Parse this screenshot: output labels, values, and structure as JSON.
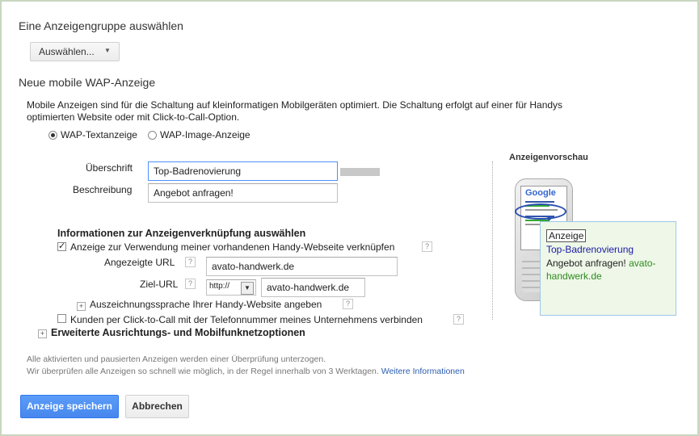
{
  "adgroup": {
    "heading": "Eine Anzeigengruppe auswählen",
    "select_label": "Auswählen..."
  },
  "new_ad": {
    "heading": "Neue mobile WAP-Anzeige",
    "description_line1": "Mobile Anzeigen sind für die Schaltung auf kleinformatigen Mobilgeräten optimiert. Die Schaltung erfolgt auf einer für Handys",
    "description_line2": "optimierten Website oder mit Click-to-Call-Option.",
    "radio_text": "WAP-Textanzeige",
    "radio_image": "WAP-Image-Anzeige"
  },
  "form": {
    "headline_label": "Überschrift",
    "headline_value": "Top-Badrenovierung",
    "description_label": "Beschreibung",
    "description_value": "Angebot anfragen!"
  },
  "linking": {
    "heading": "Informationen zur Anzeigenverknüpfung auswählen",
    "checkbox_label": "Anzeige zur Verwendung meiner vorhandenen Handy-Webseite verknüpfen",
    "display_url_label": "Angezeigte URL",
    "display_url_value": "avato-handwerk.de",
    "dest_url_label": "Ziel-URL",
    "protocol_value": "http://",
    "dest_url_value": "avato-handwerk.de",
    "markup_label": "Auszeichnungssprache Ihrer Handy-Website angeben",
    "call_label": "Kunden per Click-to-Call mit der Telefonnummer meines Unternehmens verbinden",
    "advanced_label": "Erweiterte Ausrichtungs- und Mobilfunknetzoptionen"
  },
  "help_glyph": "?",
  "expand_glyph": "+",
  "preview": {
    "title": "Anzeigenvorschau",
    "badge": "Anzeige",
    "ad_title": "Top-Badrenovierung",
    "ad_desc": "Angebot anfragen!",
    "ad_url_part1": "avato-",
    "ad_url_part2": "handwerk.de",
    "phone_logo": "Google"
  },
  "footer": {
    "note1": "Alle aktivierten und pausierten Anzeigen werden einer Überprüfung unterzogen.",
    "note2": "Wir überprüfen alle Anzeigen so schnell wie möglich, in der Regel innerhalb von 3 Werktagen.",
    "more_link": "Weitere Informationen",
    "save_button": "Anzeige speichern",
    "cancel_button": "Abbrechen"
  },
  "colors": {
    "primary_button": "#4d90fe",
    "link": "#2a5db0",
    "green": "#2e8b1e",
    "preview_bg": "#eef7e8"
  }
}
